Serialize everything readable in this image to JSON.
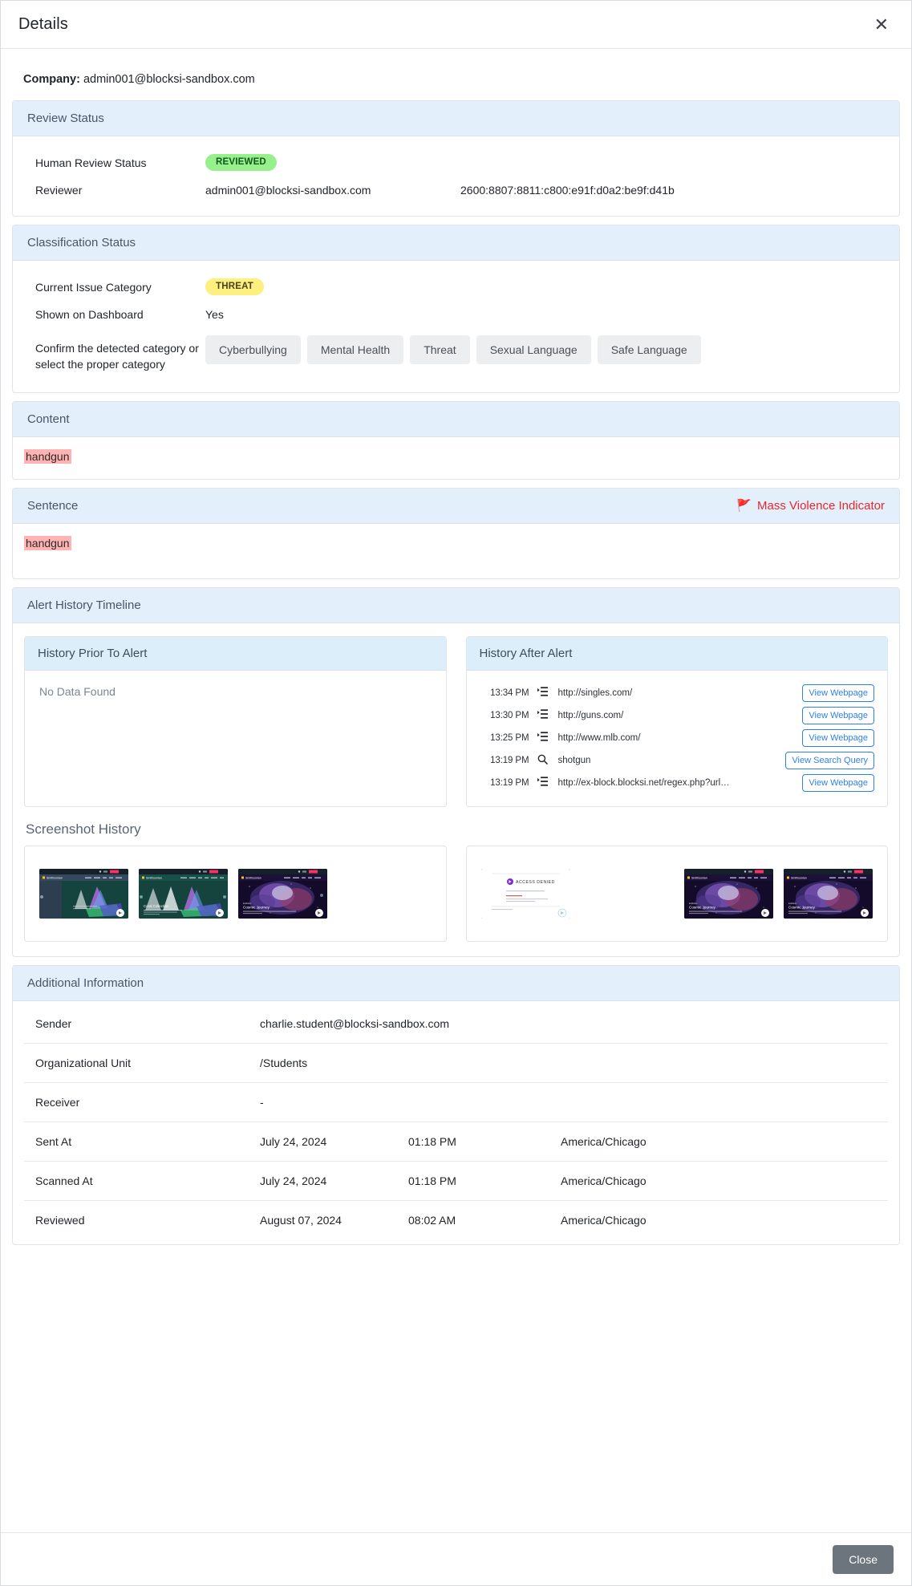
{
  "modal": {
    "title": "Details",
    "close_icon": "close-icon",
    "close_button_label": "Close"
  },
  "company": {
    "label": "Company:",
    "value": "admin001@blocksi-sandbox.com"
  },
  "review_status": {
    "title": "Review Status",
    "rows": [
      {
        "label": "Human Review Status",
        "badge": "REVIEWED",
        "badge_color": "#96f08b"
      },
      {
        "label": "Reviewer",
        "value": "admin001@blocksi-sandbox.com",
        "value2": "2600:8807:8811:c800:e91f:d0a2:be9f:d41b"
      }
    ]
  },
  "classification_status": {
    "title": "Classification Status",
    "current_issue_category_label": "Current Issue Category",
    "current_issue_category_value": "THREAT",
    "current_issue_category_color": "#fdf07f",
    "shown_on_dashboard_label": "Shown on Dashboard",
    "shown_on_dashboard_value": "Yes",
    "confirm_label": "Confirm the detected category or select the proper category",
    "categories": [
      "Cyberbullying",
      "Mental Health",
      "Threat",
      "Sexual Language",
      "Safe Language"
    ]
  },
  "content": {
    "title": "Content",
    "text": "handgun",
    "highlight_color": "#ffb3b3"
  },
  "sentence": {
    "title": "Sentence",
    "indicator": "Mass Violence Indicator",
    "indicator_icon": "red-flag-icon",
    "indicator_color": "#e8272c",
    "text": "handgun",
    "highlight_color": "#ffb3b3"
  },
  "alert_history": {
    "title": "Alert History Timeline",
    "prior": {
      "title": "History Prior To Alert",
      "empty_text": "No Data Found",
      "rows": []
    },
    "after": {
      "title": "History After Alert",
      "rows": [
        {
          "time": "13:34 PM",
          "icon": "webpage-icon",
          "text": "http://singles.com/",
          "action": "View Webpage"
        },
        {
          "time": "13:30 PM",
          "icon": "webpage-icon",
          "text": "http://guns.com/",
          "action": "View Webpage"
        },
        {
          "time": "13:25 PM",
          "icon": "webpage-icon",
          "text": "http://www.mlb.com/",
          "action": "View Webpage"
        },
        {
          "time": "13:19 PM",
          "icon": "search-icon",
          "text": "shotgun",
          "action": "View Search Query"
        },
        {
          "time": "13:19 PM",
          "icon": "webpage-icon",
          "text": "http://ex-block.blocksi.net/regex.php?url…",
          "action": "View Webpage"
        }
      ]
    },
    "screenshot_history": {
      "title": "Screenshot History",
      "left_thumbs": [
        {
          "name": "smithsonian-coral-collection-dark",
          "caption": ""
        },
        {
          "name": "smithsonian-coral-collection",
          "caption": "Coral Collection"
        },
        {
          "name": "smithsonian-cosmic-journey",
          "caption": "Cosmic Journey"
        }
      ],
      "right_thumbs": [
        {
          "name": "access-denied-page",
          "caption": "ACCESS DENIED"
        },
        {
          "name": "smithsonian-cosmic-journey",
          "caption": "Cosmic Journey"
        },
        {
          "name": "smithsonian-cosmic-journey",
          "caption": "Cosmic Journey"
        }
      ]
    }
  },
  "additional_information": {
    "title": "Additional Information",
    "rows": [
      {
        "label": "Sender",
        "v1": "charlie.student@blocksi-sandbox.com",
        "v2": "",
        "v3": ""
      },
      {
        "label": "Organizational Unit",
        "v1": "/Students",
        "v2": "",
        "v3": ""
      },
      {
        "label": "Receiver",
        "v1": "-",
        "v2": "",
        "v3": ""
      },
      {
        "label": "Sent At",
        "v1": "July 24, 2024",
        "v2": "01:18 PM",
        "v3": "America/Chicago"
      },
      {
        "label": "Scanned At",
        "v1": "July 24, 2024",
        "v2": "01:18 PM",
        "v3": "America/Chicago"
      },
      {
        "label": "Reviewed",
        "v1": "August 07, 2024",
        "v2": "08:02 AM",
        "v3": "America/Chicago"
      }
    ]
  }
}
